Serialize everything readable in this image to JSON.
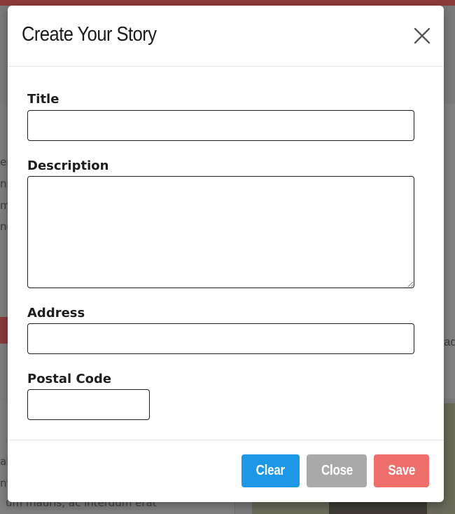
{
  "modal": {
    "title": "Create Your Story",
    "close_icon": "close-x-icon"
  },
  "form": {
    "title_label": "Title",
    "title_value": "",
    "description_label": "Description",
    "description_value": "",
    "address_label": "Address",
    "address_value": "",
    "postal_code_label": "Postal Code",
    "postal_code_value": ""
  },
  "footer": {
    "clear_label": "Clear",
    "close_label": "Close",
    "save_label": "Save"
  },
  "background": {
    "left_text_fragments": [
      "er",
      "ns",
      "m",
      "no"
    ],
    "right_text_fragment": "ad",
    "bottom_left_fragments": [
      "al",
      "nv"
    ],
    "bottom_text": "um mauris, ac interdum erat"
  },
  "colors": {
    "clear_button": "#1c98e6",
    "close_button": "#a9a9a9",
    "save_button": "#ee6e6b",
    "overlay": "#7b7b7b"
  }
}
